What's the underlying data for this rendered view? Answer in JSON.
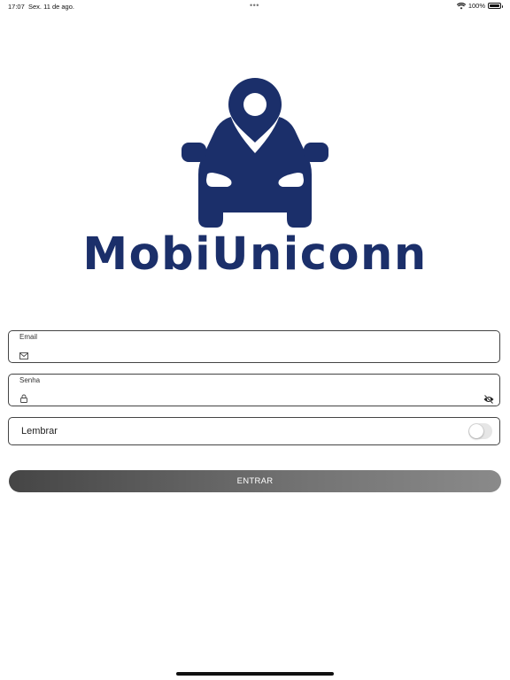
{
  "status_bar": {
    "time": "17:07",
    "date": "Sex. 11 de ago.",
    "battery": "100%",
    "dots": "•••"
  },
  "brand": {
    "name": "MobiUniconn",
    "color": "#1b2f6a"
  },
  "form": {
    "email": {
      "label": "Email",
      "icon": "mail-icon",
      "value": ""
    },
    "password": {
      "label": "Senha",
      "icon": "lock-icon",
      "value": "",
      "toggle_icon": "eye-off-icon"
    },
    "remember": {
      "label": "Lembrar",
      "enabled": false
    },
    "submit": {
      "label": "ENTRAR"
    }
  }
}
